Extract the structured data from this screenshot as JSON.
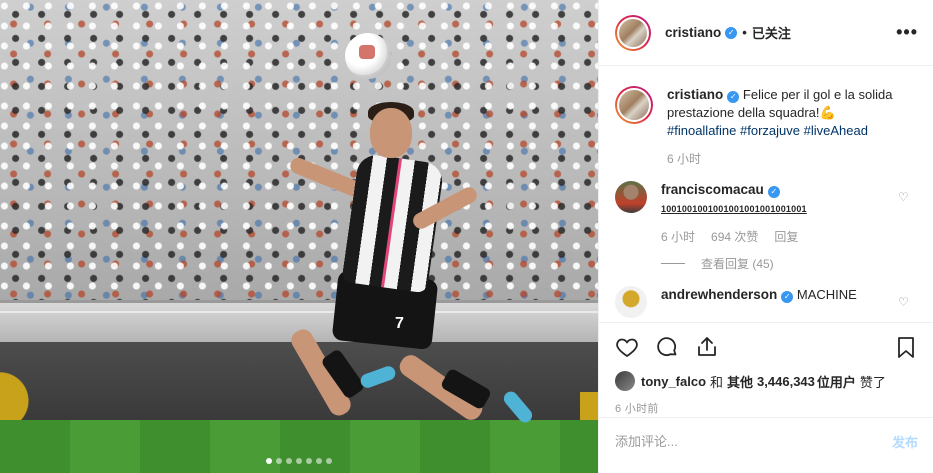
{
  "post": {
    "carousel": {
      "slide_count": 7,
      "active_index": 0
    },
    "jersey_number": "7"
  },
  "header": {
    "username": "cristiano",
    "separator": "•",
    "follow_status": "已关注",
    "more_icon": "more-dots-icon"
  },
  "caption": {
    "username": "cristiano",
    "text": "Felice per il gol e la solida prestazione della squadra!",
    "emoji": "💪",
    "hashtags": [
      "#finoallafine",
      "#forzajuve",
      "#liveAhead"
    ],
    "time": "6 小时"
  },
  "comments": [
    {
      "username": "franciscomacau",
      "text": "1001001001001001001001001001",
      "time": "6 小时",
      "likes": "694 次赞",
      "reply_label": "回复",
      "view_replies": "查看回复 (45)"
    },
    {
      "username": "andrewhenderson",
      "text": "MACHINE"
    }
  ],
  "actions": {
    "like_icon": "heart-icon",
    "comment_icon": "comment-bubble-icon",
    "share_icon": "share-icon",
    "save_icon": "bookmark-icon"
  },
  "likes": {
    "user": "tony_falco",
    "connector": "和",
    "others_label": "其他",
    "count": "3,446,343",
    "unit": "位用户",
    "suffix": "赞了"
  },
  "timestamp": "6 小时前",
  "comment_box": {
    "placeholder": "添加评论...",
    "post_label": "发布"
  },
  "colors": {
    "verified": "#3897f0",
    "hashtag": "#003569",
    "post_button": "#b3dbff",
    "muted": "#999999"
  }
}
